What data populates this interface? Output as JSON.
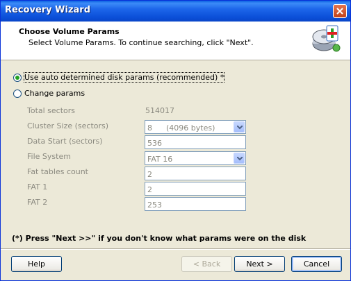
{
  "window": {
    "title": "Recovery Wizard"
  },
  "header": {
    "title": "Choose Volume Params",
    "subtitle": "Select Volume Params. To continue searching, click \"Next\"."
  },
  "options": {
    "auto_label": "Use auto determined disk params (recommended) *",
    "change_label": "Change params",
    "selected": "auto"
  },
  "fields": {
    "total_sectors_label": "Total sectors",
    "total_sectors_value": "514017",
    "cluster_size_label": "Cluster Size (sectors)",
    "cluster_size_value": "8",
    "cluster_size_bytes": "(4096 bytes)",
    "data_start_label": "Data Start (sectors)",
    "data_start_value": "536",
    "file_system_label": "File System",
    "file_system_value": "FAT 16",
    "fat_tables_label": "Fat tables count",
    "fat_tables_value": "2",
    "fat1_label": "FAT 1",
    "fat1_value": "2",
    "fat2_label": "FAT 2",
    "fat2_value": "253"
  },
  "note": "(*) Press \"Next >>\" if you don't know what params were on the disk",
  "buttons": {
    "help": "Help",
    "back": "< Back",
    "next": "Next >",
    "cancel": "Cancel"
  }
}
